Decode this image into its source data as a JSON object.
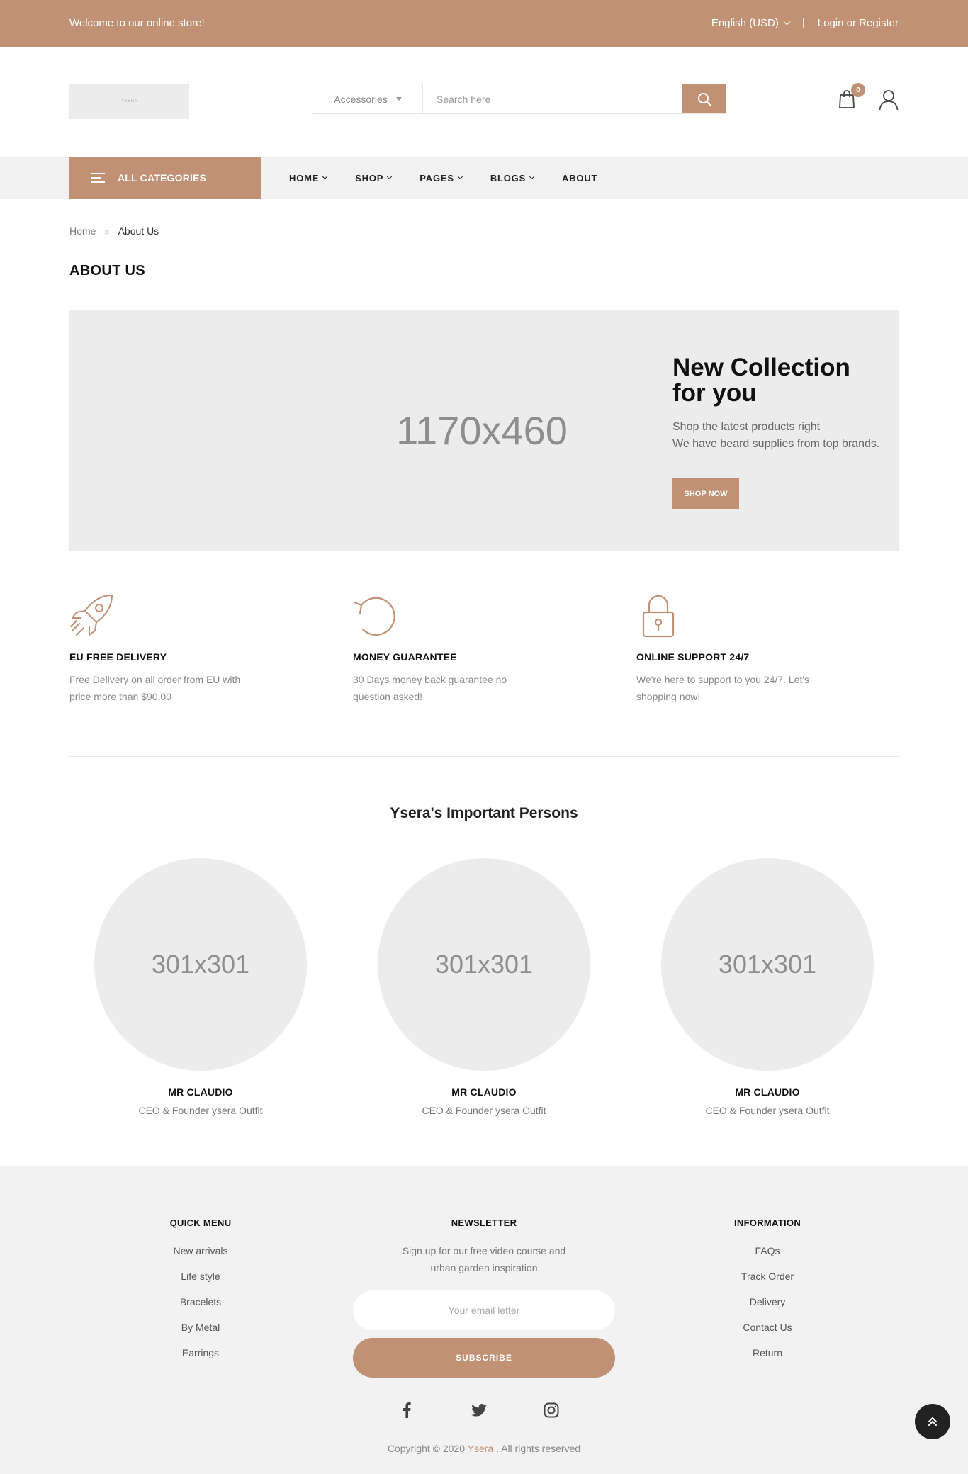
{
  "topbar": {
    "welcome": "Welcome to our online store!",
    "currency": "English (USD)",
    "separator": "|",
    "login": "Login or Register"
  },
  "header": {
    "logo_text": "YSERA",
    "search_category": "Accessories",
    "search_placeholder": "Search here",
    "cart_count": "0",
    "icons": [
      "search-icon",
      "cart-icon",
      "user-icon"
    ]
  },
  "nav": {
    "all_categories": "ALL CATEGORIES",
    "items": [
      {
        "label": "HOME",
        "has_dropdown": true
      },
      {
        "label": "SHOP",
        "has_dropdown": true
      },
      {
        "label": "PAGES",
        "has_dropdown": true
      },
      {
        "label": "BLOGS",
        "has_dropdown": true
      },
      {
        "label": "ABOUT",
        "has_dropdown": false
      }
    ]
  },
  "breadcrumb": {
    "home": "Home",
    "arrow": "»",
    "current": "About Us"
  },
  "page_title": "ABOUT US",
  "banner": {
    "placeholder": "1170x460",
    "heading_line1": "New Collection",
    "heading_line2": "for you",
    "text_line1": "Shop the latest products right",
    "text_line2": "We have beard supplies from top brands.",
    "button": "SHOP NOW"
  },
  "features": [
    {
      "icon": "rocket-icon",
      "title": "EU FREE DELIVERY",
      "text": "Free Delivery on all order from EU with price more than $90.00"
    },
    {
      "icon": "refresh-icon",
      "title": "MONEY GUARANTEE",
      "text": "30 Days money back guarantee no question asked!"
    },
    {
      "icon": "lock-icon",
      "title": "ONLINE SUPPORT 24/7",
      "text": "We're here to support to you 24/7. Let's shopping now!"
    }
  ],
  "team": {
    "title": "Ysera's Important Persons",
    "members": [
      {
        "photo": "301x301",
        "name": "MR CLAUDIO",
        "role": "CEO & Founder ysera Outfit"
      },
      {
        "photo": "301x301",
        "name": "MR CLAUDIO",
        "role": "CEO & Founder ysera Outfit"
      },
      {
        "photo": "301x301",
        "name": "MR CLAUDIO",
        "role": "CEO & Founder ysera Outfit"
      }
    ]
  },
  "footer": {
    "quick_menu": {
      "title": "QUICK MENU",
      "items": [
        "New arrivals",
        "Life style",
        "Bracelets",
        "By Metal",
        "Earrings"
      ]
    },
    "newsletter": {
      "title": "NEWSLETTER",
      "text_line1": "Sign up for our free video course and",
      "text_line2": "urban garden inspiration",
      "email_placeholder": "Your email letter",
      "button": "SUBSCRIBE"
    },
    "information": {
      "title": "INFORMATION",
      "items": [
        "FAQs",
        "Track Order",
        "Delivery",
        "Contact Us",
        "Return"
      ]
    },
    "social": [
      "facebook-icon",
      "twitter-icon",
      "instagram-icon"
    ],
    "copyright_prefix": "Copyright © 2020",
    "copyright_brand": "Ysera",
    "copyright_suffix": ". All rights reserved"
  },
  "colors": {
    "accent": "#c09174",
    "dark": "#222222",
    "placeholder_bg": "#ececec"
  }
}
